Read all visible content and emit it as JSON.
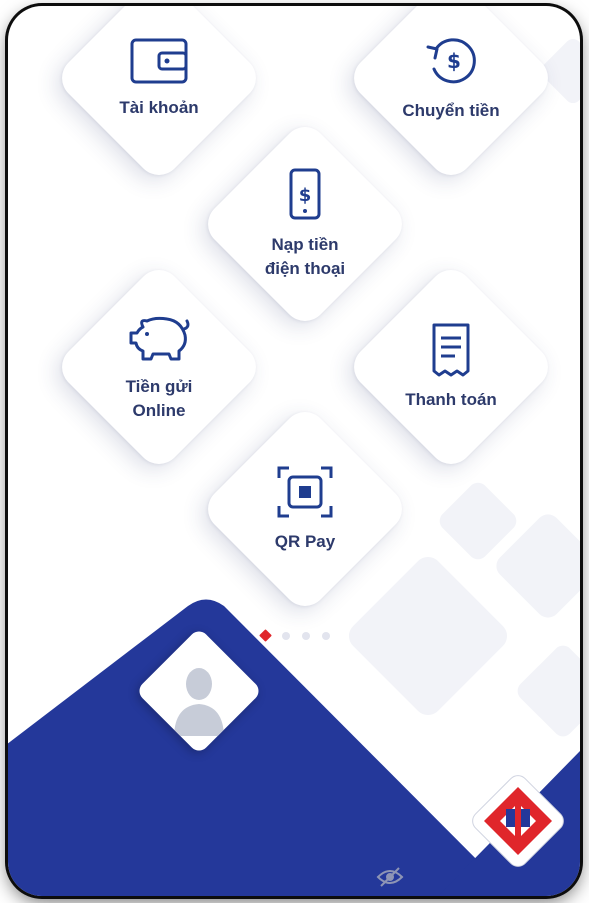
{
  "menu": {
    "items": [
      {
        "id": "account",
        "label": "Tài khoản",
        "icon": "wallet-icon"
      },
      {
        "id": "transfer",
        "label": "Chuyển tiền",
        "icon": "money-transfer-icon"
      },
      {
        "id": "topup",
        "label": "Nạp tiền\nđiện thoại",
        "icon": "phone-dollar-icon"
      },
      {
        "id": "deposit",
        "label": "Tiền gửi\nOnline",
        "icon": "piggy-bank-icon"
      },
      {
        "id": "payment",
        "label": "Thanh toán",
        "icon": "receipt-icon"
      },
      {
        "id": "qrpay",
        "label": "QR Pay",
        "icon": "qr-scan-icon"
      }
    ]
  },
  "pager": {
    "count": 4,
    "active": 0
  },
  "profile": {
    "avatar": "user-silhouette"
  },
  "footer": {
    "toggle_icon": "eye-slash-icon"
  },
  "colors": {
    "brand_blue": "#24389a",
    "accent_red": "#e0262b",
    "label_text": "#2d3a6b",
    "icon_blue": "#1f3d8f"
  }
}
